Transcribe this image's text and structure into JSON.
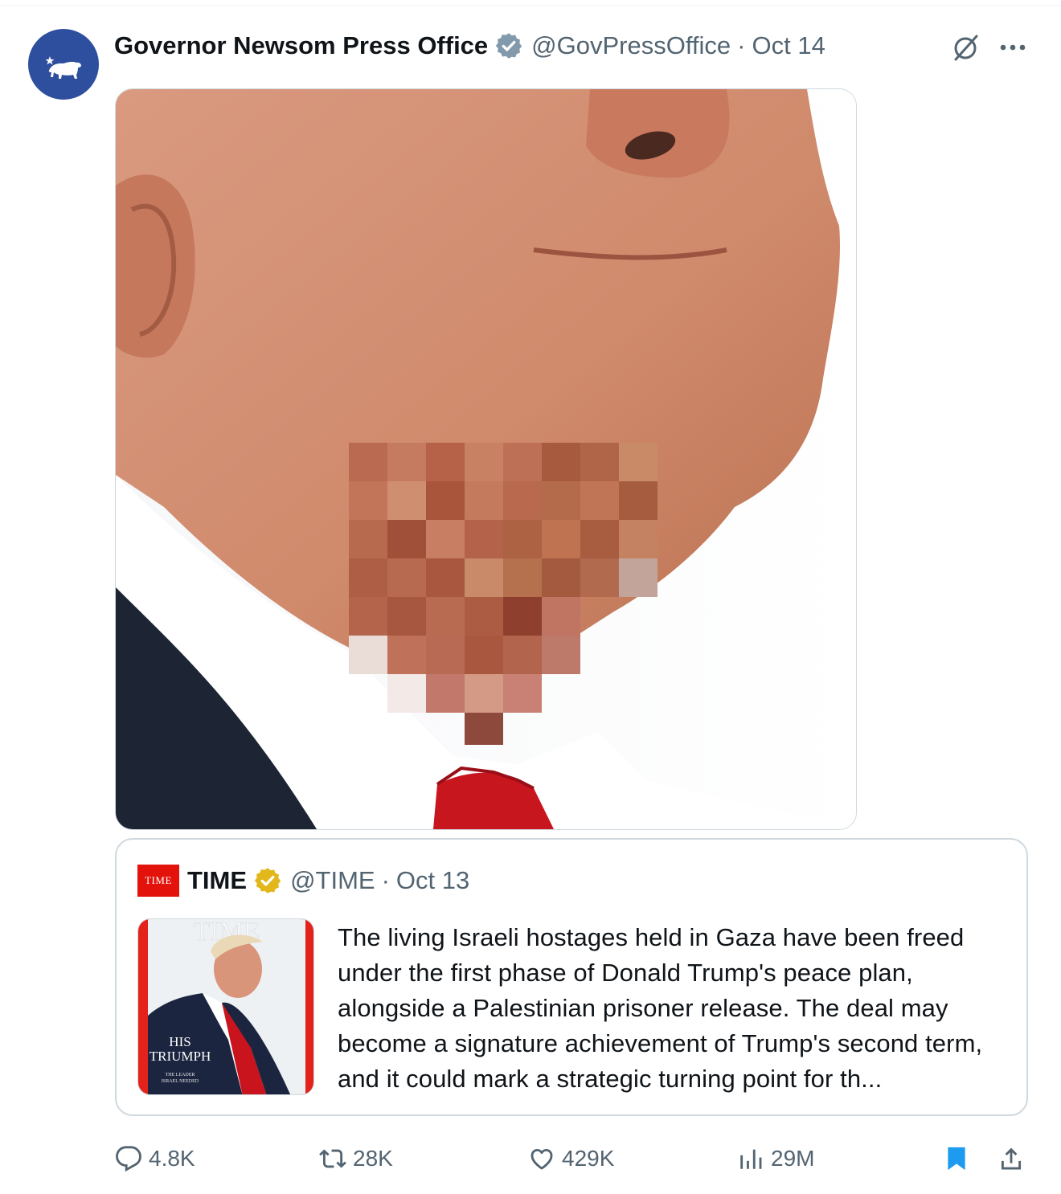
{
  "tweet": {
    "author_name": "Governor Newsom Press Office",
    "handle": "@GovPressOffice",
    "separator": "·",
    "date": "Oct 14",
    "avatar_icon": "california-bear-logo",
    "verified_color": "#829aab"
  },
  "header_icons": {
    "grok": "grok-icon",
    "more": "more-icon"
  },
  "media": {
    "description_icon": "photo-pixelated-chin"
  },
  "quote": {
    "logo_text": "TIME",
    "author_name": "TIME",
    "handle": "@TIME",
    "separator": "·",
    "date": "Oct 13",
    "verified_color": "#e2b719",
    "thumbnail": {
      "masthead": "TIME",
      "cover_line_1": "HIS",
      "cover_line_2": "TRIUMPH",
      "cover_small_1": "THE LEADER",
      "cover_small_2": "ISRAEL NEEDED"
    },
    "text": "The living Israeli hostages held in Gaza have been freed under the first phase of Donald Trump's peace plan, alongside a Palestinian prisoner release. The deal may become a signature achievement of Trump's second term, and it could mark a strategic turning point for th..."
  },
  "actions": {
    "replies": "4.8K",
    "reposts": "28K",
    "likes": "429K",
    "views": "29M",
    "bookmark_color": "#1d9bf0"
  }
}
